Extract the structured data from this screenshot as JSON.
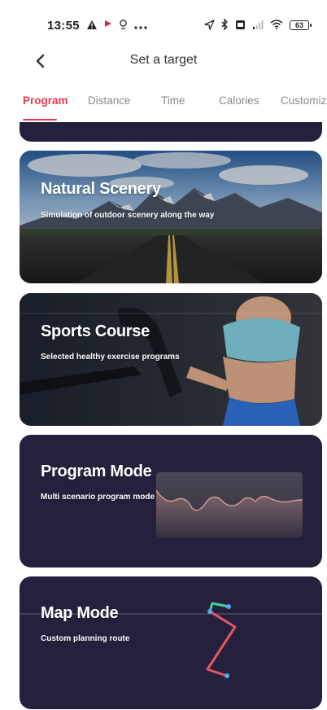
{
  "status_bar": {
    "time": "13:55",
    "battery": "63",
    "left_icons": [
      "warning-icon",
      "flag-icon",
      "location-pin-icon",
      "more-icon"
    ],
    "right_icons": [
      "navigation-icon",
      "bluetooth-icon",
      "sim-icon",
      "signal-icon",
      "wifi-icon",
      "battery-icon"
    ]
  },
  "header": {
    "title": "Set a target",
    "back_icon": "chevron-left-icon"
  },
  "tabs": [
    {
      "label": "Program",
      "active": true
    },
    {
      "label": "Distance",
      "active": false
    },
    {
      "label": "Time",
      "active": false
    },
    {
      "label": "Calories",
      "active": false
    },
    {
      "label": "Customize",
      "active": false
    }
  ],
  "cards": [
    {
      "title": "Natural Scenery",
      "subtitle": "Simulation of outdoor scenery along the way"
    },
    {
      "title": "Sports Course",
      "subtitle": "Selected healthy exercise programs"
    },
    {
      "title": "Program Mode",
      "subtitle": "Multi scenario program mode"
    },
    {
      "title": "Map Mode",
      "subtitle": "Custom planning route"
    }
  ],
  "colors": {
    "accent": "#e13a4f",
    "card_dark": "#25213d",
    "route_red": "#e85468",
    "route_green": "#44d39a",
    "route_point": "#58a8ff"
  }
}
